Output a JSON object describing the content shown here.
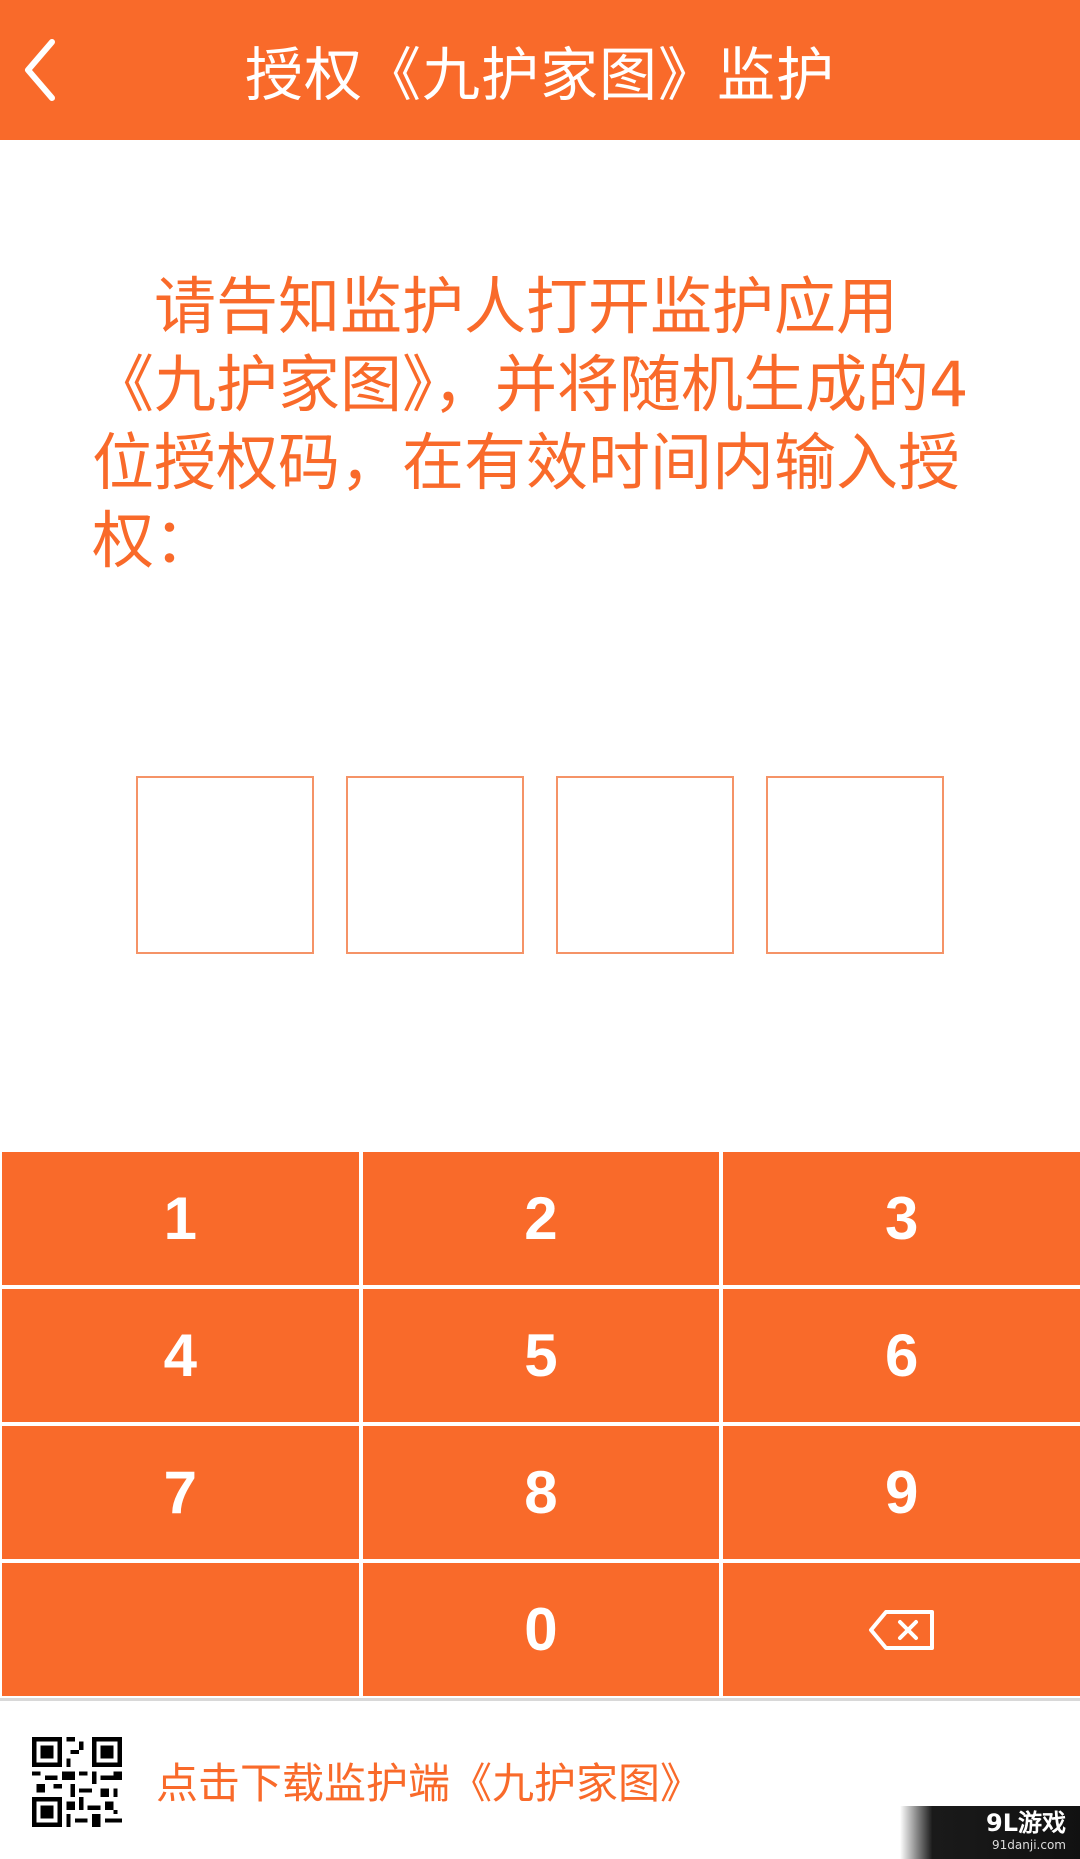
{
  "header": {
    "title": "授权《九护家图》监护",
    "back_icon": "chevron-left-icon"
  },
  "instruction": "请告知监护人打开监护应用《九护家图》，并将随机生成的4位授权码，在有效时间内输入授权：",
  "code": {
    "digits": [
      "",
      "",
      "",
      ""
    ]
  },
  "keypad": {
    "keys": [
      "1",
      "2",
      "3",
      "4",
      "5",
      "6",
      "7",
      "8",
      "9",
      "",
      "0"
    ],
    "delete_icon": "backspace-icon"
  },
  "footer": {
    "qr_icon": "qr-code-icon",
    "download_label": "点击下载监护端《九护家图》"
  },
  "watermark": {
    "main": "9L游戏",
    "sub": "91danji.com"
  },
  "colors": {
    "accent": "#F96A2A",
    "box_border": "#F59367",
    "background": "#FFFFFF"
  }
}
